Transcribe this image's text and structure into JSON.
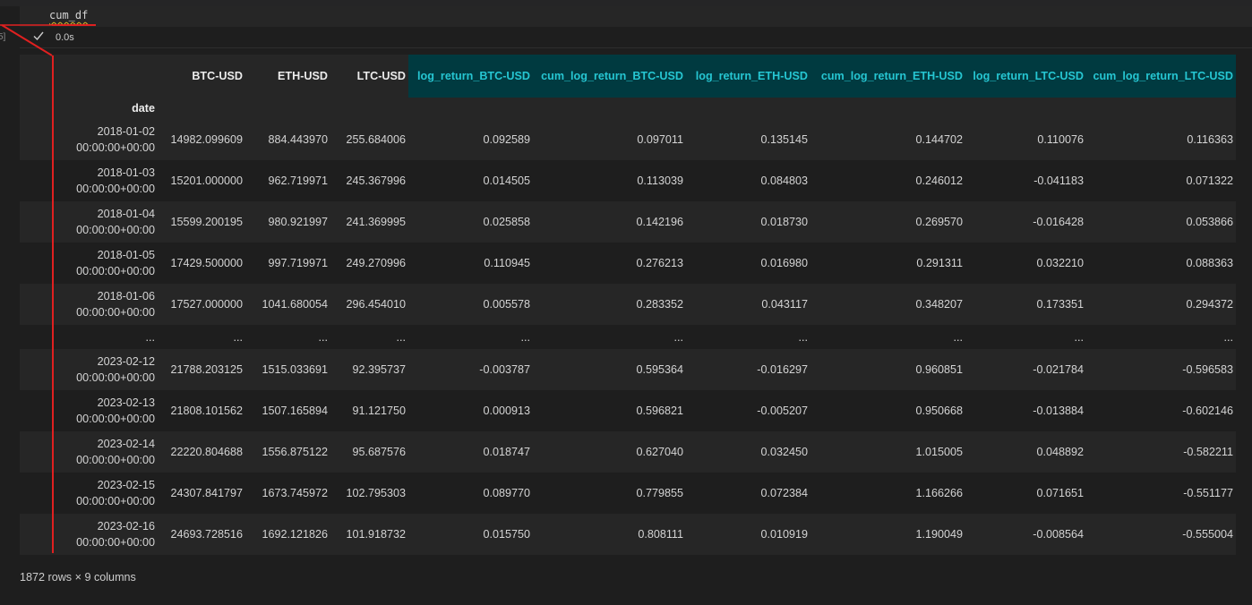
{
  "cell": {
    "code": "cum_df",
    "exec_count": "5]",
    "status_icon": "check-icon",
    "exec_time": "0.0s"
  },
  "table": {
    "index_name": "date",
    "columns": [
      {
        "label": "BTC-USD",
        "highlight": false
      },
      {
        "label": "ETH-USD",
        "highlight": false
      },
      {
        "label": "LTC-USD",
        "highlight": false
      },
      {
        "label": "log_return_BTC-USD",
        "highlight": true
      },
      {
        "label": "cum_log_return_BTC-USD",
        "highlight": true
      },
      {
        "label": "log_return_ETH-USD",
        "highlight": true
      },
      {
        "label": "cum_log_return_ETH-USD",
        "highlight": true
      },
      {
        "label": "log_return_LTC-USD",
        "highlight": true
      },
      {
        "label": "cum_log_return_LTC-USD",
        "highlight": true
      }
    ],
    "rows": [
      {
        "date": "2018-01-02 00:00:00+00:00",
        "values": [
          "14982.099609",
          "884.443970",
          "255.684006",
          "0.092589",
          "0.097011",
          "0.135145",
          "0.144702",
          "0.110076",
          "0.116363"
        ]
      },
      {
        "date": "2018-01-03 00:00:00+00:00",
        "values": [
          "15201.000000",
          "962.719971",
          "245.367996",
          "0.014505",
          "0.113039",
          "0.084803",
          "0.246012",
          "-0.041183",
          "0.071322"
        ]
      },
      {
        "date": "2018-01-04 00:00:00+00:00",
        "values": [
          "15599.200195",
          "980.921997",
          "241.369995",
          "0.025858",
          "0.142196",
          "0.018730",
          "0.269570",
          "-0.016428",
          "0.053866"
        ]
      },
      {
        "date": "2018-01-05 00:00:00+00:00",
        "values": [
          "17429.500000",
          "997.719971",
          "249.270996",
          "0.110945",
          "0.276213",
          "0.016980",
          "0.291311",
          "0.032210",
          "0.088363"
        ]
      },
      {
        "date": "2018-01-06 00:00:00+00:00",
        "values": [
          "17527.000000",
          "1041.680054",
          "296.454010",
          "0.005578",
          "0.283352",
          "0.043117",
          "0.348207",
          "0.173351",
          "0.294372"
        ]
      },
      {
        "date": "...",
        "values": [
          "...",
          "...",
          "...",
          "...",
          "...",
          "...",
          "...",
          "...",
          "..."
        ],
        "ellipsis": true
      },
      {
        "date": "2023-02-12 00:00:00+00:00",
        "values": [
          "21788.203125",
          "1515.033691",
          "92.395737",
          "-0.003787",
          "0.595364",
          "-0.016297",
          "0.960851",
          "-0.021784",
          "-0.596583"
        ]
      },
      {
        "date": "2023-02-13 00:00:00+00:00",
        "values": [
          "21808.101562",
          "1507.165894",
          "91.121750",
          "0.000913",
          "0.596821",
          "-0.005207",
          "0.950668",
          "-0.013884",
          "-0.602146"
        ]
      },
      {
        "date": "2023-02-14 00:00:00+00:00",
        "values": [
          "22220.804688",
          "1556.875122",
          "95.687576",
          "0.018747",
          "0.627040",
          "0.032450",
          "1.015005",
          "0.048892",
          "-0.582211"
        ]
      },
      {
        "date": "2023-02-15 00:00:00+00:00",
        "values": [
          "24307.841797",
          "1673.745972",
          "102.795303",
          "0.089770",
          "0.779855",
          "0.072384",
          "1.166266",
          "0.071651",
          "-0.551177"
        ]
      },
      {
        "date": "2023-02-16 00:00:00+00:00",
        "values": [
          "24693.728516",
          "1692.121826",
          "101.918732",
          "0.015750",
          "0.808111",
          "0.010919",
          "1.190049",
          "-0.008564",
          "-0.555004"
        ]
      }
    ],
    "shape_text": "1872 rows × 9 columns"
  },
  "colors": {
    "background": "#1e1e1e",
    "header_highlight_bg": "#003a40",
    "header_highlight_text": "#26c6d2",
    "annotation": "#e02020",
    "check": "#cccccc"
  }
}
